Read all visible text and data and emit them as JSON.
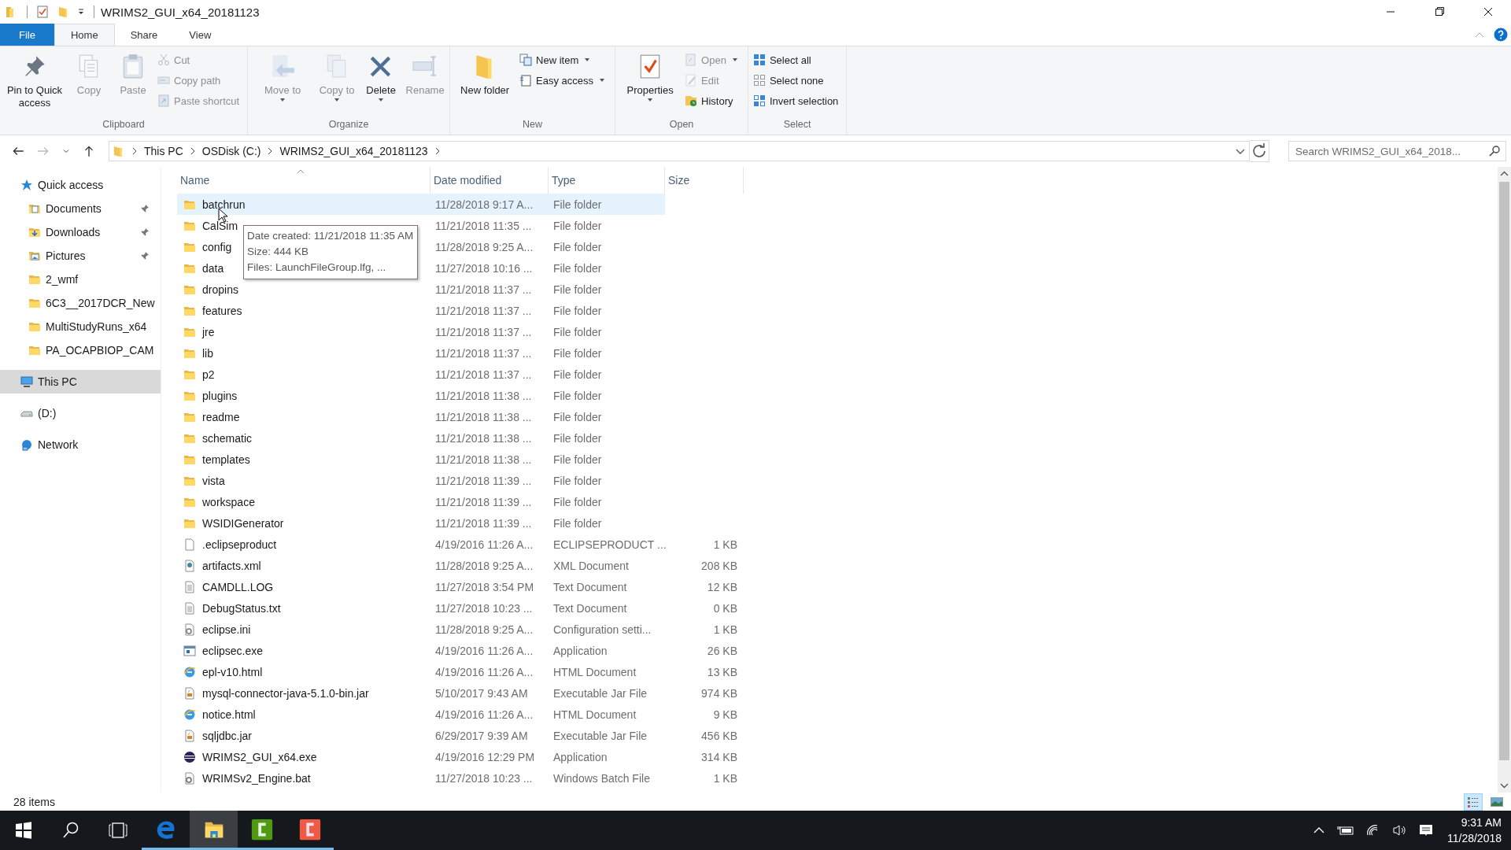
{
  "window": {
    "title": "WRIMS2_GUI_x64_20181123"
  },
  "ribbon_tabs": [
    {
      "label": "File",
      "kind": "file",
      "selected": false
    },
    {
      "label": "Home",
      "kind": "tab",
      "selected": true
    },
    {
      "label": "Share",
      "kind": "tab",
      "selected": false
    },
    {
      "label": "View",
      "kind": "tab",
      "selected": false
    }
  ],
  "ribbon_groups": [
    {
      "label": "Clipboard",
      "buttons": [
        {
          "label": "Pin to Quick access",
          "kind": "pin",
          "disabled": false,
          "menu": false
        },
        {
          "label": "Copy",
          "kind": "copy",
          "disabled": true,
          "menu": false
        },
        {
          "label": "Paste",
          "kind": "paste",
          "disabled": true,
          "menu": false
        }
      ],
      "commands": [
        {
          "label": "Cut",
          "kind": "cut",
          "disabled": true,
          "menu": false
        },
        {
          "label": "Copy path",
          "kind": "copypath",
          "disabled": true,
          "menu": false
        },
        {
          "label": "Paste shortcut",
          "kind": "pasteshortcut",
          "disabled": true,
          "menu": false
        }
      ]
    },
    {
      "label": "Organize",
      "buttons": [
        {
          "label": "Move to",
          "kind": "move",
          "disabled": true,
          "menu": true
        },
        {
          "label": "Copy to",
          "kind": "copyto",
          "disabled": true,
          "menu": true
        },
        {
          "label": "Delete",
          "kind": "delete",
          "disabled": false,
          "menu": true
        },
        {
          "label": "Rename",
          "kind": "rename",
          "disabled": true,
          "menu": false
        }
      ]
    },
    {
      "label": "New",
      "buttons": [
        {
          "label": "New folder",
          "kind": "newfolder",
          "disabled": false,
          "menu": false
        }
      ],
      "commands": [
        {
          "label": "New item",
          "kind": "newitem",
          "disabled": false,
          "menu": true
        },
        {
          "label": "Easy access",
          "kind": "easyaccess",
          "disabled": false,
          "menu": true
        }
      ]
    },
    {
      "label": "Open",
      "buttons": [
        {
          "label": "Properties",
          "kind": "properties",
          "disabled": false,
          "menu": true
        }
      ],
      "commands": [
        {
          "label": "Open",
          "kind": "open",
          "disabled": true,
          "menu": true
        },
        {
          "label": "Edit",
          "kind": "edit",
          "disabled": true,
          "menu": false
        },
        {
          "label": "History",
          "kind": "history",
          "disabled": false,
          "menu": false
        }
      ]
    },
    {
      "label": "Select",
      "commands": [
        {
          "label": "Select all",
          "kind": "selectall",
          "disabled": false,
          "menu": false
        },
        {
          "label": "Select none",
          "kind": "selectnone",
          "disabled": false,
          "menu": false
        },
        {
          "label": "Invert selection",
          "kind": "invert",
          "disabled": false,
          "menu": false
        }
      ]
    }
  ],
  "address": {
    "crumbs": [
      "This PC",
      "OSDisk (C:)",
      "WRIMS2_GUI_x64_20181123"
    ],
    "search_placeholder": "Search WRIMS2_GUI_x64_2018..."
  },
  "nav": [
    {
      "label": "Quick access",
      "kind": "quick",
      "selected": false,
      "children": [
        {
          "label": "Documents",
          "kind": "documents",
          "pinned": true,
          "selected": false
        },
        {
          "label": "Downloads",
          "kind": "downloads",
          "pinned": true,
          "selected": false
        },
        {
          "label": "Pictures",
          "kind": "pictures",
          "pinned": true,
          "selected": false
        },
        {
          "label": "2_wmf",
          "kind": "folder",
          "pinned": false,
          "selected": false
        },
        {
          "label": "6C3__2017DCR_New",
          "kind": "folder",
          "pinned": false,
          "selected": false
        },
        {
          "label": "MultiStudyRuns_x64",
          "kind": "folder",
          "pinned": false,
          "selected": false
        },
        {
          "label": "PA_OCAPBIOP_CAM",
          "kind": "folder",
          "pinned": false,
          "selected": false
        }
      ]
    },
    {
      "label": "This PC",
      "kind": "pc",
      "selected": true
    },
    {
      "label": "(D:)",
      "kind": "drive",
      "selected": false
    },
    {
      "label": "Network",
      "kind": "network",
      "selected": false
    }
  ],
  "columns": [
    "Name",
    "Date modified",
    "Type",
    "Size"
  ],
  "files": [
    {
      "name": "batchrun",
      "date": "11/28/2018 9:17 A...",
      "type": "File folder",
      "kind": "folder",
      "selected": true
    },
    {
      "name": "CalSim",
      "date": "11/21/2018 11:35 ...",
      "type": "File folder",
      "kind": "folder",
      "selected": false
    },
    {
      "name": "config",
      "date": "11/28/2018 9:25 A...",
      "type": "File folder",
      "kind": "folder",
      "selected": false
    },
    {
      "name": "data",
      "date": "11/27/2018 10:16 ...",
      "type": "File folder",
      "kind": "folder",
      "selected": false
    },
    {
      "name": "dropins",
      "date": "11/21/2018 11:37 ...",
      "type": "File folder",
      "kind": "folder",
      "selected": false
    },
    {
      "name": "features",
      "date": "11/21/2018 11:37 ...",
      "type": "File folder",
      "kind": "folder",
      "selected": false
    },
    {
      "name": "jre",
      "date": "11/21/2018 11:37 ...",
      "type": "File folder",
      "kind": "folder",
      "selected": false
    },
    {
      "name": "lib",
      "date": "11/21/2018 11:37 ...",
      "type": "File folder",
      "kind": "folder",
      "selected": false
    },
    {
      "name": "p2",
      "date": "11/21/2018 11:37 ...",
      "type": "File folder",
      "kind": "folder",
      "selected": false
    },
    {
      "name": "plugins",
      "date": "11/21/2018 11:38 ...",
      "type": "File folder",
      "kind": "folder",
      "selected": false
    },
    {
      "name": "readme",
      "date": "11/21/2018 11:38 ...",
      "type": "File folder",
      "kind": "folder",
      "selected": false
    },
    {
      "name": "schematic",
      "date": "11/21/2018 11:38 ...",
      "type": "File folder",
      "kind": "folder",
      "selected": false
    },
    {
      "name": "templates",
      "date": "11/21/2018 11:38 ...",
      "type": "File folder",
      "kind": "folder",
      "selected": false
    },
    {
      "name": "vista",
      "date": "11/21/2018 11:39 ...",
      "type": "File folder",
      "kind": "folder",
      "selected": false
    },
    {
      "name": "workspace",
      "date": "11/21/2018 11:39 ...",
      "type": "File folder",
      "kind": "folder",
      "selected": false
    },
    {
      "name": "WSIDIGenerator",
      "date": "11/21/2018 11:39 ...",
      "type": "File folder",
      "kind": "folder",
      "selected": false
    },
    {
      "name": ".eclipseproduct",
      "date": "4/19/2016 11:26 A...",
      "type": "ECLIPSEPRODUCT ...",
      "size": "1 KB",
      "kind": "blank",
      "selected": false
    },
    {
      "name": "artifacts.xml",
      "date": "11/28/2018 9:25 A...",
      "type": "XML Document",
      "size": "208 KB",
      "kind": "xml",
      "selected": false
    },
    {
      "name": "CAMDLL.LOG",
      "date": "11/27/2018 3:54 PM",
      "type": "Text Document",
      "size": "12 KB",
      "kind": "text",
      "selected": false
    },
    {
      "name": "DebugStatus.txt",
      "date": "11/27/2018 10:23 ...",
      "type": "Text Document",
      "size": "0 KB",
      "kind": "text",
      "selected": false
    },
    {
      "name": "eclipse.ini",
      "date": "11/28/2018 9:25 A...",
      "type": "Configuration setti...",
      "size": "1 KB",
      "kind": "ini",
      "selected": false
    },
    {
      "name": "eclipsec.exe",
      "date": "4/19/2016 11:26 A...",
      "type": "Application",
      "size": "26 KB",
      "kind": "exe",
      "selected": false
    },
    {
      "name": "epl-v10.html",
      "date": "4/19/2016 11:26 A...",
      "type": "HTML Document",
      "size": "13 KB",
      "kind": "html",
      "selected": false
    },
    {
      "name": "mysql-connector-java-5.1.0-bin.jar",
      "date": "5/10/2017 9:43 AM",
      "type": "Executable Jar File",
      "size": "974 KB",
      "kind": "jar",
      "selected": false
    },
    {
      "name": "notice.html",
      "date": "4/19/2016 11:26 A...",
      "type": "HTML Document",
      "size": "9 KB",
      "kind": "html",
      "selected": false
    },
    {
      "name": "sqljdbc.jar",
      "date": "6/29/2017 9:39 AM",
      "type": "Executable Jar File",
      "size": "456 KB",
      "kind": "jar",
      "selected": false
    },
    {
      "name": "WRIMS2_GUI_x64.exe",
      "date": "4/19/2016 12:29 PM",
      "type": "Application",
      "size": "314 KB",
      "kind": "app",
      "selected": false
    },
    {
      "name": "WRIMSv2_Engine.bat",
      "date": "11/27/2018 10:23 ...",
      "type": "Windows Batch File",
      "size": "1 KB",
      "kind": "bat",
      "selected": false
    }
  ],
  "tooltip": [
    "Date created: 11/21/2018 11:35 AM",
    "Size: 444 KB",
    "Files: LaunchFileGroup.lfg, ..."
  ],
  "status_bar": {
    "count": "28 items",
    "views": [
      {
        "kind": "details",
        "selected": true
      },
      {
        "kind": "large",
        "selected": false
      }
    ]
  },
  "taskbar": {
    "apps": [
      {
        "kind": "browser",
        "running": true,
        "selected": false
      },
      {
        "kind": "explorer",
        "running": true,
        "selected": true
      },
      {
        "kind": "green",
        "running": true,
        "selected": false
      },
      {
        "kind": "red",
        "running": true,
        "selected": false
      }
    ],
    "time": "9:31 AM",
    "date": "11/28/2018"
  }
}
